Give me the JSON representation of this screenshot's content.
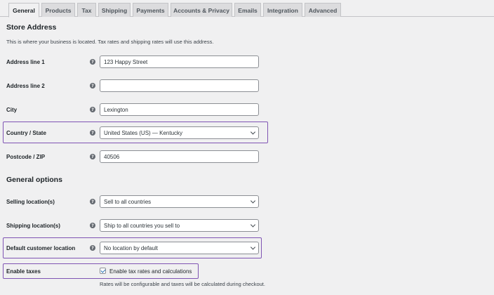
{
  "tabs": [
    {
      "label": "General",
      "active": true
    },
    {
      "label": "Products"
    },
    {
      "label": "Tax"
    },
    {
      "label": "Shipping"
    },
    {
      "label": "Payments"
    },
    {
      "label": "Accounts & Privacy"
    },
    {
      "label": "Emails"
    },
    {
      "label": "Integration"
    },
    {
      "label": "Advanced"
    }
  ],
  "store_address": {
    "title": "Store Address",
    "description": "This is where your business is located. Tax rates and shipping rates will use this address.",
    "address_line_1": {
      "label": "Address line 1",
      "value": "123 Happy Street"
    },
    "address_line_2": {
      "label": "Address line 2",
      "value": ""
    },
    "city": {
      "label": "City",
      "value": "Lexington"
    },
    "country_state": {
      "label": "Country / State",
      "value": "United States (US) — Kentucky"
    },
    "postcode": {
      "label": "Postcode / ZIP",
      "value": "40506"
    }
  },
  "general_options": {
    "title": "General options",
    "selling_location": {
      "label": "Selling location(s)",
      "value": "Sell to all countries"
    },
    "shipping_location": {
      "label": "Shipping location(s)",
      "value": "Ship to all countries you sell to"
    },
    "default_customer_location": {
      "label": "Default customer location",
      "value": "No location by default"
    },
    "enable_taxes": {
      "label": "Enable taxes",
      "checked": true,
      "checkbox_label": "Enable tax rates and calculations",
      "description": "Rates will be configurable and taxes will be calculated during checkout."
    }
  },
  "help_icon_glyph": "?",
  "colors": {
    "highlight": "#7f54b3",
    "background": "#f0f0f1",
    "tab_inactive": "#dcdcde",
    "checkmark": "#2271b1"
  }
}
